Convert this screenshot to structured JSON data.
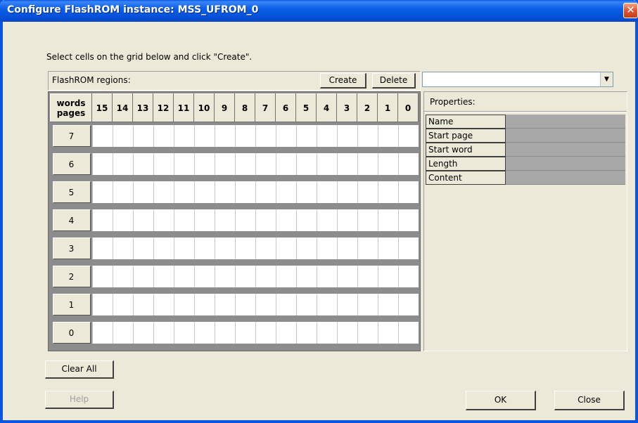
{
  "window": {
    "title": "Configure FlashROM instance: MSS_UFROM_0",
    "close_glyph": "✕"
  },
  "instruction": "Select cells on the grid below and click \"Create\".",
  "regions": {
    "label": "FlashROM regions:",
    "create_label": "Create",
    "delete_label": "Delete",
    "selected_region": ""
  },
  "grid": {
    "corner_top": "words",
    "corner_bottom": "pages",
    "word_columns": [
      "15",
      "14",
      "13",
      "12",
      "11",
      "10",
      "9",
      "8",
      "7",
      "6",
      "5",
      "4",
      "3",
      "2",
      "1",
      "0"
    ],
    "page_rows": [
      "7",
      "6",
      "5",
      "4",
      "3",
      "2",
      "1",
      "0"
    ]
  },
  "properties": {
    "title": "Properties:",
    "rows": [
      {
        "name": "Name",
        "value": ""
      },
      {
        "name": "Start page",
        "value": ""
      },
      {
        "name": "Start word",
        "value": ""
      },
      {
        "name": "Length",
        "value": ""
      },
      {
        "name": "Content",
        "value": ""
      }
    ]
  },
  "buttons": {
    "clear_all": "Clear All",
    "help": "Help",
    "ok": "OK",
    "close": "Close"
  },
  "icons": {
    "combo_arrow": "chevron-down-icon",
    "close": "close-icon"
  },
  "colors": {
    "titlebar": "#0a56e8",
    "window_bg": "#ece9d8",
    "close_button": "#e0552f",
    "property_value_bg": "#a8a8a8"
  }
}
